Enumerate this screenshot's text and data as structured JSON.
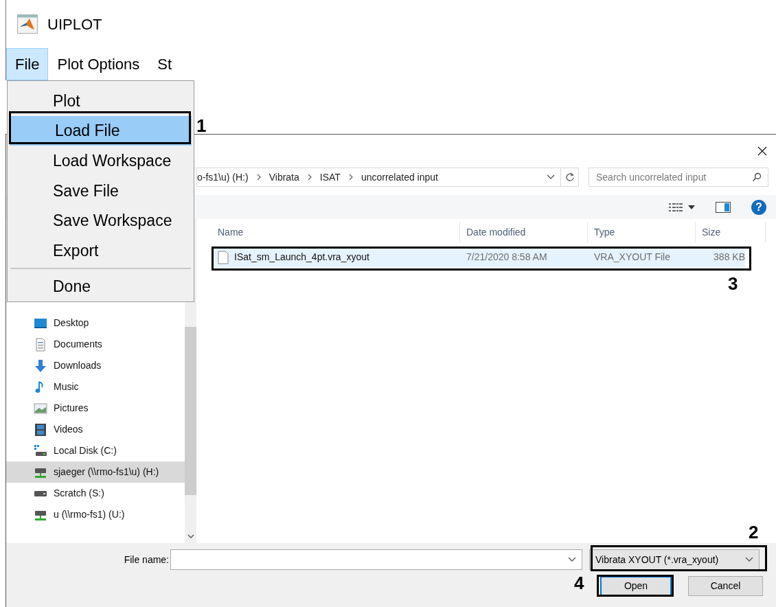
{
  "uiplot": {
    "title": "UIPLOT",
    "menubar": [
      {
        "label": "File",
        "selected": true
      },
      {
        "label": "Plot Options",
        "selected": false
      },
      {
        "label": "St",
        "selected": false
      }
    ],
    "menu": [
      {
        "kind": "item",
        "label": "Plot",
        "selected": false
      },
      {
        "kind": "item",
        "label": "Load File",
        "selected": true
      },
      {
        "kind": "item",
        "label": "Load Workspace",
        "selected": false
      },
      {
        "kind": "item",
        "label": "Save File",
        "selected": false
      },
      {
        "kind": "item",
        "label": "Save Workspace",
        "selected": false
      },
      {
        "kind": "item",
        "label": "Export",
        "selected": false
      },
      {
        "kind": "separator"
      },
      {
        "kind": "item",
        "label": "Done",
        "selected": false
      }
    ]
  },
  "dialog": {
    "breadcrumbs": [
      "o-fs1\\u) (H:)",
      "Vibrata",
      "ISAT",
      "uncorrelated input"
    ],
    "search": {
      "placeholder": "Search uncorrelated input"
    },
    "help_button": "?",
    "sidebar": [
      {
        "label": "Desktop",
        "selected": false
      },
      {
        "label": "Documents",
        "selected": false
      },
      {
        "label": "Downloads",
        "selected": false
      },
      {
        "label": "Music",
        "selected": false
      },
      {
        "label": "Pictures",
        "selected": false
      },
      {
        "label": "Videos",
        "selected": false
      },
      {
        "label": "Local Disk (C:)",
        "selected": false
      },
      {
        "label": "sjaeger (\\\\rmo-fs1\\u) (H:)",
        "selected": true
      },
      {
        "label": "Scratch (S:)",
        "selected": false
      },
      {
        "label": "u (\\\\rmo-fs1) (U:)",
        "selected": false
      }
    ],
    "columns": [
      "Name",
      "Date modified",
      "Type",
      "Size"
    ],
    "files": [
      {
        "name": "ISat_sm_Launch_4pt.vra_xyout",
        "date": "7/21/2020 8:58 AM",
        "type": "VRA_XYOUT File",
        "size": "388 KB",
        "selected": true
      }
    ],
    "file_name": {
      "label": "File name:"
    },
    "filter": {
      "value": "Vibrata XYOUT (*.vra_xyout)"
    },
    "buttons": [
      "Open",
      "Cancel"
    ]
  },
  "annotations": [
    "1",
    "2",
    "3",
    "4"
  ]
}
